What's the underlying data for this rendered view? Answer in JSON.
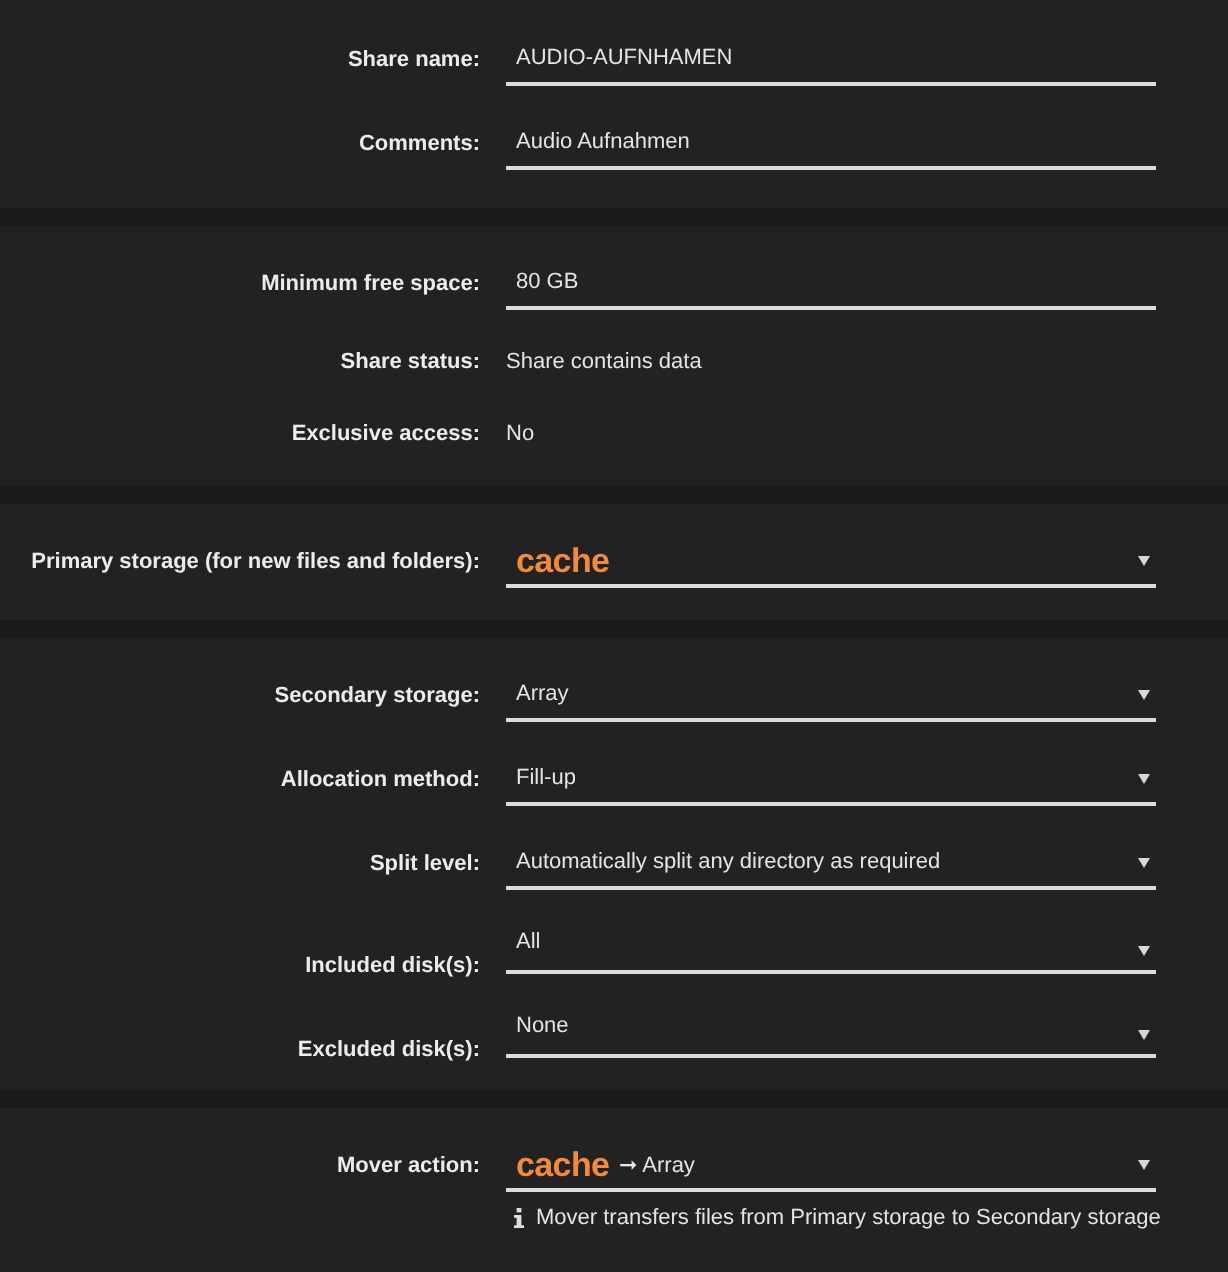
{
  "sections": [
    {
      "rows": [
        {
          "kind": "input",
          "label": "Share name:",
          "value": [
            {
              "text": "AUDIO-AUFNHAMEN",
              "highlight": false
            }
          ]
        },
        {
          "kind": "input",
          "label": "Comments:",
          "value": [
            {
              "text": "Audio Aufnahmen",
              "highlight": false
            }
          ]
        }
      ]
    },
    {
      "rows": [
        {
          "kind": "input",
          "label": "Minimum free space:",
          "value": [
            {
              "text": "80 GB",
              "highlight": false
            }
          ]
        },
        {
          "kind": "static",
          "label": "Share status:",
          "text": "Share contains data"
        },
        {
          "kind": "static",
          "label": "Exclusive access:",
          "text": "No"
        }
      ]
    },
    {
      "rows": [
        {
          "kind": "select",
          "label": "Primary storage (for new files and folders):",
          "value": [
            {
              "text": "cache",
              "highlight": true
            }
          ]
        }
      ]
    },
    {
      "rows": [
        {
          "kind": "select",
          "label": "Secondary storage:",
          "value": [
            {
              "text": "Array",
              "highlight": false
            }
          ]
        },
        {
          "kind": "select",
          "label": "Allocation method:",
          "value": [
            {
              "text": "Fill-up",
              "highlight": false
            }
          ]
        },
        {
          "kind": "select",
          "label": "Split level:",
          "value": [
            {
              "text": "Automatically split any directory as required",
              "highlight": false
            }
          ]
        },
        {
          "kind": "multiselect",
          "label": "Included disk(s):",
          "value": [
            {
              "text": "All",
              "highlight": false
            }
          ]
        },
        {
          "kind": "multiselect",
          "label": "Excluded disk(s):",
          "value": [
            {
              "text": "None",
              "highlight": false
            }
          ]
        }
      ]
    },
    {
      "rows": [
        {
          "kind": "select",
          "label": "Mover action:",
          "value": [
            {
              "text": "cache",
              "highlight": true
            },
            {
              "text": "➞ Array",
              "highlight": false
            }
          ],
          "help": "Mover transfers files from Primary storage to Secondary storage"
        }
      ]
    }
  ]
}
